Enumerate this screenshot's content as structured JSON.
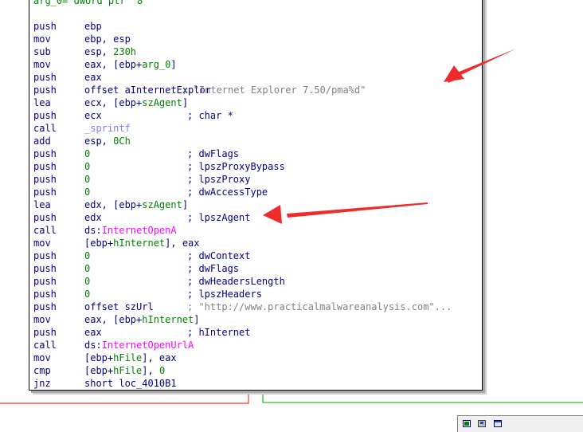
{
  "header_fragment": "arg_0= dword ptr  8",
  "colors": {
    "mnemonic": "#000080",
    "number": "#008000",
    "api": "#ff00ff",
    "comment": "#808080",
    "annotation_arrow": "#ee2b2b"
  },
  "lines": [
    {
      "mnemonic": "push",
      "op_parts": [
        {
          "t": "ebp"
        }
      ],
      "comment": ""
    },
    {
      "mnemonic": "mov",
      "op_parts": [
        {
          "t": "ebp, esp"
        }
      ],
      "comment": ""
    },
    {
      "mnemonic": "sub",
      "op_parts": [
        {
          "t": "esp, "
        },
        {
          "t": "230h",
          "c": "num"
        }
      ],
      "comment": ""
    },
    {
      "mnemonic": "mov",
      "op_parts": [
        {
          "t": "eax, [ebp+"
        },
        {
          "t": "arg_0",
          "c": "var"
        },
        {
          "t": "]"
        }
      ],
      "comment": ""
    },
    {
      "mnemonic": "push",
      "op_parts": [
        {
          "t": "eax"
        }
      ],
      "comment": ""
    },
    {
      "mnemonic": "push",
      "op_parts": [
        {
          "t": "offset aInternetExplor"
        }
      ],
      "comment": " ; \"Internet Explorer 7.50/pma%d\"",
      "comment_style": "gray"
    },
    {
      "mnemonic": "lea",
      "op_parts": [
        {
          "t": "ecx, [ebp+"
        },
        {
          "t": "szAgent",
          "c": "var"
        },
        {
          "t": "]"
        }
      ],
      "comment": ""
    },
    {
      "mnemonic": "push",
      "op_parts": [
        {
          "t": "ecx"
        }
      ],
      "comment": "; char *",
      "comment_style": "blue"
    },
    {
      "mnemonic": "call",
      "op_parts": [
        {
          "t": "_sprintf",
          "c": "sub"
        }
      ],
      "comment": ""
    },
    {
      "mnemonic": "add",
      "op_parts": [
        {
          "t": "esp, "
        },
        {
          "t": "0Ch",
          "c": "num"
        }
      ],
      "comment": ""
    },
    {
      "mnemonic": "push",
      "op_parts": [
        {
          "t": "0",
          "c": "num"
        }
      ],
      "comment": "; dwFlags",
      "comment_style": "blue"
    },
    {
      "mnemonic": "push",
      "op_parts": [
        {
          "t": "0",
          "c": "num"
        }
      ],
      "comment": "; lpszProxyBypass",
      "comment_style": "blue"
    },
    {
      "mnemonic": "push",
      "op_parts": [
        {
          "t": "0",
          "c": "num"
        }
      ],
      "comment": "; lpszProxy",
      "comment_style": "blue"
    },
    {
      "mnemonic": "push",
      "op_parts": [
        {
          "t": "0",
          "c": "num"
        }
      ],
      "comment": "; dwAccessType",
      "comment_style": "blue"
    },
    {
      "mnemonic": "lea",
      "op_parts": [
        {
          "t": "edx, [ebp+"
        },
        {
          "t": "szAgent",
          "c": "var"
        },
        {
          "t": "]"
        }
      ],
      "comment": ""
    },
    {
      "mnemonic": "push",
      "op_parts": [
        {
          "t": "edx"
        }
      ],
      "comment": "; lpszAgent",
      "comment_style": "blue"
    },
    {
      "mnemonic": "call",
      "op_parts": [
        {
          "t": "ds:"
        },
        {
          "t": "InternetOpenA",
          "c": "fn"
        }
      ],
      "comment": ""
    },
    {
      "mnemonic": "mov",
      "op_parts": [
        {
          "t": "[ebp+"
        },
        {
          "t": "hInternet",
          "c": "var"
        },
        {
          "t": "], eax"
        }
      ],
      "comment": ""
    },
    {
      "mnemonic": "push",
      "op_parts": [
        {
          "t": "0",
          "c": "num"
        }
      ],
      "comment": "; dwContext",
      "comment_style": "blue"
    },
    {
      "mnemonic": "push",
      "op_parts": [
        {
          "t": "0",
          "c": "num"
        }
      ],
      "comment": "; dwFlags",
      "comment_style": "blue"
    },
    {
      "mnemonic": "push",
      "op_parts": [
        {
          "t": "0",
          "c": "num"
        }
      ],
      "comment": "; dwHeadersLength",
      "comment_style": "blue"
    },
    {
      "mnemonic": "push",
      "op_parts": [
        {
          "t": "0",
          "c": "num"
        }
      ],
      "comment": "; lpszHeaders",
      "comment_style": "blue"
    },
    {
      "mnemonic": "push",
      "op_parts": [
        {
          "t": "offset szUrl"
        }
      ],
      "comment": "; \"http://www.practicalmalwareanalysis.com\"...",
      "comment_style": "gray"
    },
    {
      "mnemonic": "mov",
      "op_parts": [
        {
          "t": "eax, [ebp+"
        },
        {
          "t": "hInternet",
          "c": "var"
        },
        {
          "t": "]"
        }
      ],
      "comment": ""
    },
    {
      "mnemonic": "push",
      "op_parts": [
        {
          "t": "eax"
        }
      ],
      "comment": "; hInternet",
      "comment_style": "blue"
    },
    {
      "mnemonic": "call",
      "op_parts": [
        {
          "t": "ds:"
        },
        {
          "t": "InternetOpenUrlA",
          "c": "fn"
        }
      ],
      "comment": ""
    },
    {
      "mnemonic": "mov",
      "op_parts": [
        {
          "t": "[ebp+"
        },
        {
          "t": "hFile",
          "c": "var"
        },
        {
          "t": "], eax"
        }
      ],
      "comment": ""
    },
    {
      "mnemonic": "cmp",
      "op_parts": [
        {
          "t": "[ebp+"
        },
        {
          "t": "hFile",
          "c": "var"
        },
        {
          "t": "], "
        },
        {
          "t": "0",
          "c": "num"
        }
      ],
      "comment": ""
    },
    {
      "mnemonic": "jnz",
      "op_parts": [
        {
          "t": "short loc_4010B1"
        }
      ],
      "comment": ""
    }
  ],
  "toolbar_icons": [
    "graph-overview-icon",
    "disk-icon",
    "window-icon"
  ]
}
